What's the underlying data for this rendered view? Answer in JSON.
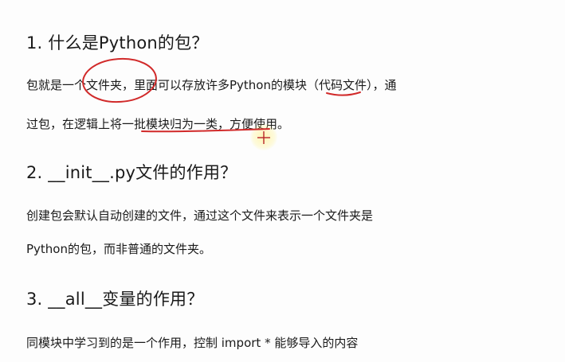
{
  "sections": [
    {
      "heading": "1. 什么是Python的包？",
      "lines": [
        "包就是一个文件夹，里面可以存放许多Python的模块（代码文件），通",
        "过包，在逻辑上将一批模块归为一类，方便使用。"
      ]
    },
    {
      "heading": "2. __init__.py文件的作用？",
      "lines": [
        "创建包会默认自动创建的文件，通过这个文件来表示一个文件夹是",
        "Python的包，而非普通的文件夹。"
      ]
    },
    {
      "heading": "3. __all__变量的作用？",
      "lines": [
        "同模块中学习到的是一个作用，控制 import * 能够导入的内容"
      ]
    }
  ],
  "annotation_color": "#d12a2a",
  "cursor_icon": "crosshair-cursor-icon"
}
